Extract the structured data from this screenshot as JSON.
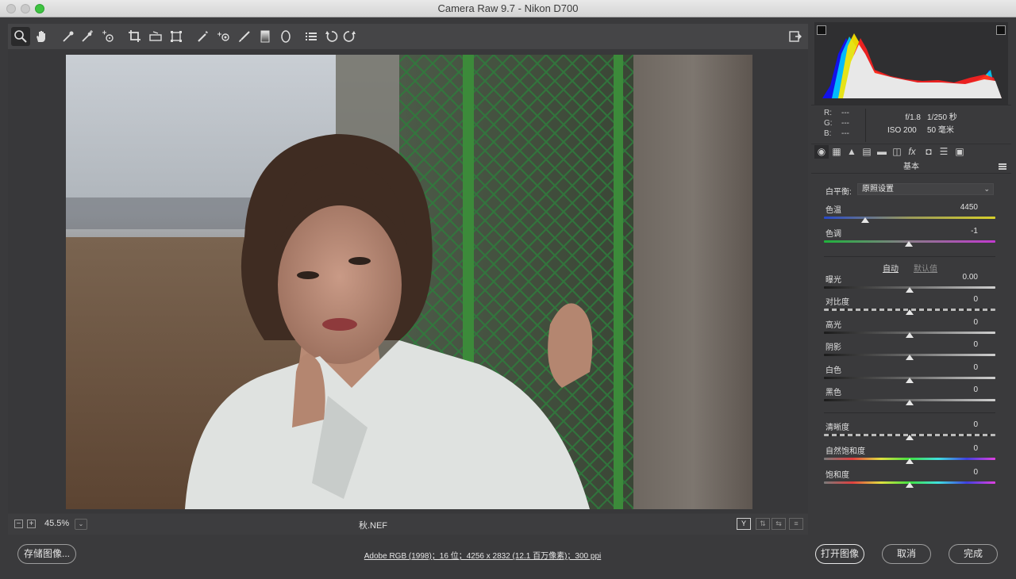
{
  "window": {
    "title": "Camera Raw 9.7 -  Nikon D700"
  },
  "toolbar": {
    "tools": [
      {
        "name": "zoom-tool-icon",
        "active": true
      },
      {
        "name": "hand-tool-icon"
      },
      {
        "name": "white-balance-tool-icon"
      },
      {
        "name": "color-sampler-tool-icon"
      },
      {
        "name": "targeted-adjustment-tool-icon"
      },
      {
        "name": "crop-tool-icon"
      },
      {
        "name": "straighten-tool-icon"
      },
      {
        "name": "transform-tool-icon"
      },
      {
        "name": "spot-removal-tool-icon"
      },
      {
        "name": "red-eye-removal-icon"
      },
      {
        "name": "adjustment-brush-icon"
      },
      {
        "name": "graduated-filter-icon"
      },
      {
        "name": "radial-filter-icon"
      },
      {
        "name": "preferences-icon"
      },
      {
        "name": "rotate-left-icon"
      },
      {
        "name": "rotate-right-icon"
      }
    ],
    "export_icon": "export-icon"
  },
  "preview": {
    "zoom": "45.5%",
    "filename": "秋.NEF"
  },
  "info": {
    "r_label": "R:",
    "g_label": "G:",
    "b_label": "B:",
    "r_value": "---",
    "g_value": "---",
    "b_value": "---",
    "aperture": "f/1.8",
    "shutter": "1/250 秒",
    "iso": "ISO 200",
    "focal": "50 毫米"
  },
  "panel": {
    "section_title": "基本",
    "white_balance_label": "白平衡:",
    "white_balance_value": "原照设置",
    "auto_label": "自动",
    "default_label": "默认值",
    "sliders": [
      {
        "key": "temp",
        "label": "色温",
        "value": "4450",
        "position": 0.24,
        "track": "t-temp"
      },
      {
        "key": "tint",
        "label": "色调",
        "value": "-1",
        "position": 0.495,
        "track": "t-tint"
      },
      {
        "key": "exposure",
        "label": "曝光",
        "value": "0.00",
        "position": 0.5,
        "track": "t-gray"
      },
      {
        "key": "contrast",
        "label": "对比度",
        "value": "0",
        "position": 0.5,
        "track": "t-dash"
      },
      {
        "key": "highlights",
        "label": "高光",
        "value": "0",
        "position": 0.5,
        "track": "t-gray"
      },
      {
        "key": "shadows",
        "label": "阴影",
        "value": "0",
        "position": 0.5,
        "track": "t-gray"
      },
      {
        "key": "whites",
        "label": "白色",
        "value": "0",
        "position": 0.5,
        "track": "t-gray"
      },
      {
        "key": "blacks",
        "label": "黑色",
        "value": "0",
        "position": 0.5,
        "track": "t-gray"
      },
      {
        "key": "clarity",
        "label": "清晰度",
        "value": "0",
        "position": 0.5,
        "track": "t-dash"
      },
      {
        "key": "vibrance",
        "label": "自然饱和度",
        "value": "0",
        "position": 0.5,
        "track": "t-sat"
      },
      {
        "key": "saturation",
        "label": "饱和度",
        "value": "0",
        "position": 0.5,
        "track": "t-sat"
      }
    ]
  },
  "bottom": {
    "save_label": "存储图像...",
    "workflow_link": "Adobe RGB (1998)；16 位；4256 x 2832 (12.1 百万像素)；300 ppi",
    "open_label": "打开图像",
    "cancel_label": "取消",
    "done_label": "完成"
  },
  "colors": {
    "panel_bg": "#3a3a3c",
    "preview_bg": "#38383a",
    "accent_green": "#3ec341"
  }
}
